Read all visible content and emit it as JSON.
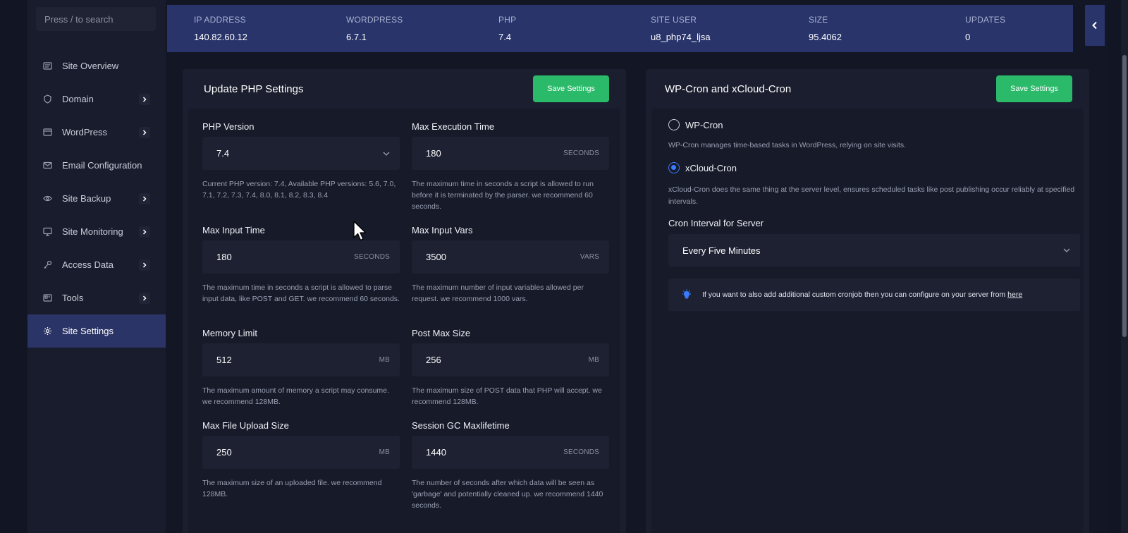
{
  "search": {
    "placeholder": "Press / to search"
  },
  "sidebar": {
    "items": [
      {
        "label": "Site Overview",
        "icon": "site-overview-icon",
        "has_chevron": false
      },
      {
        "label": "Domain",
        "icon": "shield-icon",
        "has_chevron": true
      },
      {
        "label": "WordPress",
        "icon": "wordpress-icon",
        "has_chevron": true
      },
      {
        "label": "Email Configuration",
        "icon": "mail-icon",
        "has_chevron": false
      },
      {
        "label": "Site Backup",
        "icon": "backup-icon",
        "has_chevron": true
      },
      {
        "label": "Site Monitoring",
        "icon": "monitor-icon",
        "has_chevron": true
      },
      {
        "label": "Access Data",
        "icon": "key-icon",
        "has_chevron": true
      },
      {
        "label": "Tools",
        "icon": "tools-icon",
        "has_chevron": true
      },
      {
        "label": "Site Settings",
        "icon": "gear-icon",
        "has_chevron": false,
        "active": true
      }
    ]
  },
  "infobar": {
    "items": [
      {
        "label": "IP ADDRESS",
        "value": "140.82.60.12"
      },
      {
        "label": "WORDPRESS",
        "value": "6.7.1"
      },
      {
        "label": "PHP",
        "value": "7.4"
      },
      {
        "label": "SITE USER",
        "value": "u8_php74_ljsa"
      },
      {
        "label": "SIZE",
        "value": "95.4062"
      },
      {
        "label": "UPDATES",
        "value": "0"
      }
    ]
  },
  "php_panel": {
    "title": "Update PHP Settings",
    "save_label": "Save Settings",
    "fields": {
      "php_version": {
        "label": "PHP Version",
        "value": "7.4",
        "help": "Current PHP version: 7.4, Available PHP versions: 5.6, 7.0, 7.1, 7.2, 7.3, 7.4, 8.0, 8.1, 8.2, 8.3, 8.4"
      },
      "max_execution_time": {
        "label": "Max Execution Time",
        "value": "180",
        "unit": "SECONDS",
        "help": "The maximum time in seconds a script is allowed to run before it is terminated by the parser. we recommend 60 seconds."
      },
      "max_input_time": {
        "label": "Max Input Time",
        "value": "180",
        "unit": "SECONDS",
        "help": "The maximum time in seconds a script is allowed to parse input data, like POST and GET. we recommend 60 seconds."
      },
      "max_input_vars": {
        "label": "Max Input Vars",
        "value": "3500",
        "unit": "VARS",
        "help": "The maximum number of input variables allowed per request. we recommend 1000 vars."
      },
      "memory_limit": {
        "label": "Memory Limit",
        "value": "512",
        "unit": "MB",
        "help": "The maximum amount of memory a script may consume. we recommend 128MB."
      },
      "post_max_size": {
        "label": "Post Max Size",
        "value": "256",
        "unit": "MB",
        "help": "The maximum size of POST data that PHP will accept. we recommend 128MB."
      },
      "max_file_upload_size": {
        "label": "Max File Upload Size",
        "value": "250",
        "unit": "MB",
        "help": "The maximum size of an uploaded file. we recommend 128MB."
      },
      "session_gc_maxlifetime": {
        "label": "Session GC Maxlifetime",
        "value": "1440",
        "unit": "SECONDS",
        "help": "The number of seconds after which data will be seen as 'garbage' and potentially cleaned up. we recommend 1440 seconds."
      }
    }
  },
  "cron_panel": {
    "title": "WP-Cron and xCloud-Cron",
    "save_label": "Save Settings",
    "wp_cron": {
      "label": "WP-Cron",
      "checked": false,
      "help": "WP-Cron manages time-based tasks in WordPress, relying on site visits."
    },
    "xcloud_cron": {
      "label": "xCloud-Cron",
      "checked": true,
      "help": "xCloud-Cron does the same thing at the server level, ensures scheduled tasks like post publishing occur reliably at specified intervals."
    },
    "interval_label": "Cron Interval for Server",
    "interval_value": "Every Five Minutes",
    "tip_text": "If you want to also add additional custom cronjob then you can configure on your server from",
    "tip_link": "here"
  },
  "colors": {
    "accent": "#2bba6a",
    "infobar": "#28346a",
    "active_nav": "#2b3466",
    "radio": "#3b7bff"
  }
}
